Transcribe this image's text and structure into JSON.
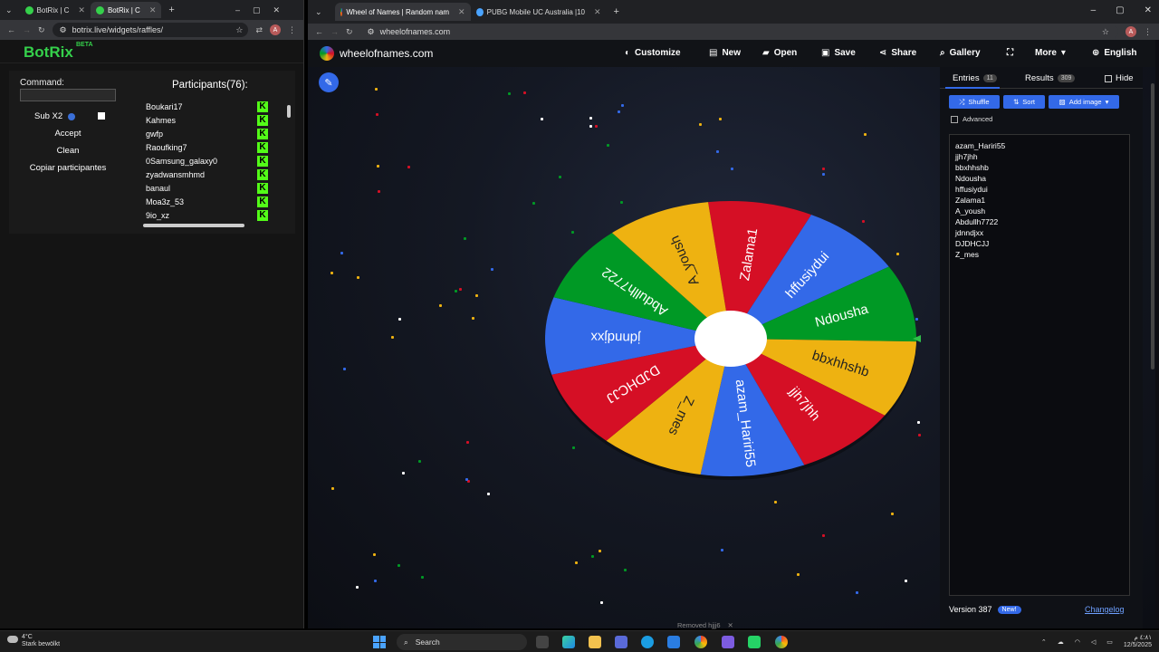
{
  "left_window": {
    "tabs": [
      {
        "label": "BotRix | C"
      },
      {
        "label": "BotRix | C"
      }
    ],
    "url": "botrix.live/widgets/raffles/",
    "brand": "BotRix",
    "beta": "BETA",
    "command_label": "Command:",
    "sub_label": "Sub X2",
    "accept": "Accept",
    "clean": "Clean",
    "copy": "Copiar participantes",
    "participants_title": "Participants(76):",
    "participants": [
      "Boukari17",
      "Kahmes",
      "gwfp",
      "Raoufking7",
      "0Samsung_galaxy0",
      "zyadwansmhmd",
      "banaul",
      "Moa3z_53",
      "9io_xz"
    ],
    "platform_glyph": "K"
  },
  "right_window": {
    "tabs": [
      {
        "label": "Wheel of Names | Random nam"
      },
      {
        "label": "PUBG Mobile UC Australia |10"
      }
    ],
    "url": "wheelofnames.com",
    "site_name": "wheelofnames.com",
    "nav": [
      "Customize",
      "New",
      "Open",
      "Save",
      "Share",
      "Gallery",
      "More",
      "English"
    ],
    "sidebar": {
      "entries_tab": "Entries",
      "entries_count": "11",
      "results_tab": "Results",
      "results_count": "309",
      "hide": "Hide",
      "shuffle": "Shuffle",
      "sort": "Sort",
      "add_image": "Add image",
      "advanced": "Advanced",
      "entries": [
        "azam_Hariri55",
        "jjh7jhh",
        "bbxhhshb",
        "Ndousha",
        "hffusiydui",
        "Zalama1",
        "A_yoush",
        "Abdullh7722",
        "jdnndjxx",
        "DJDHCJJ",
        "Z_mes"
      ],
      "version": "Version 387",
      "new_badge": "New!",
      "changelog": "Changelog"
    },
    "wheel": {
      "segments": [
        {
          "label": "Zalama1",
          "color": "#d50f25"
        },
        {
          "label": "hffusiydui",
          "color": "#3369e8"
        },
        {
          "label": "Ndousha",
          "color": "#009925"
        },
        {
          "label": "bbxhhshb",
          "color": "#eeb211"
        },
        {
          "label": "jjh7jhh",
          "color": "#d50f25"
        },
        {
          "label": "azam_Hariri55",
          "color": "#3369e8"
        },
        {
          "label": "Z_mes",
          "color": "#eeb211"
        },
        {
          "label": "DJDHCJJ",
          "color": "#d50f25"
        },
        {
          "label": "jdnndjxx",
          "color": "#3369e8"
        },
        {
          "label": "Abdullh7722",
          "color": "#009925"
        },
        {
          "label": "A_yoush",
          "color": "#eeb211"
        }
      ]
    },
    "toast": "Removed hjjj6"
  },
  "taskbar": {
    "temp": "4°C",
    "weather": "Stark bewölkt",
    "search": "Search",
    "time": "٤:٨١ م",
    "date": "12/5/2025"
  },
  "colors": {
    "botrix_green": "#35d04b",
    "kick_green": "#53fc18",
    "accent_blue": "#3369e8"
  }
}
